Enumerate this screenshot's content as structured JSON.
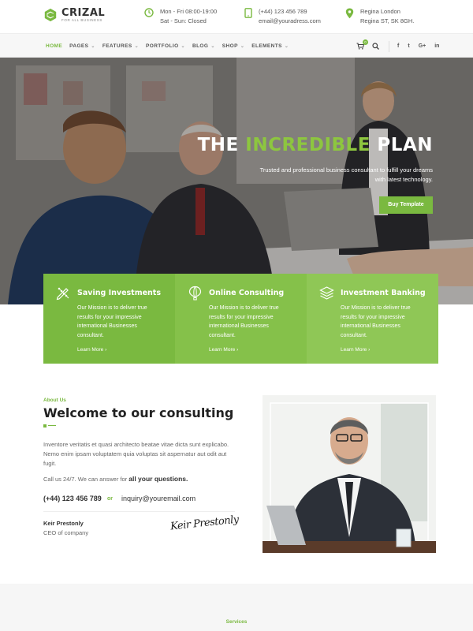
{
  "brand": {
    "name": "CRIZAL",
    "tagline": "FOR ALL BUSINESS",
    "accent": "#7ab940"
  },
  "contacts": [
    {
      "icon": "clock-icon",
      "line1": "Mon - Fri 08:00-19:00",
      "line2": "Sat - Sun: Closed"
    },
    {
      "icon": "phone-icon",
      "line1": "(+44) 123 456 789",
      "line2": "email@youradress.com"
    },
    {
      "icon": "map-pin-icon",
      "line1": "Regina London",
      "line2": "Regina ST, SK 8GH."
    }
  ],
  "nav": {
    "items": [
      "HOME",
      "PAGES",
      "FEATURES",
      "PORTFOLIO",
      "BLOG",
      "SHOP",
      "ELEMENTS"
    ],
    "active": "HOME",
    "cart_count": "0",
    "social": [
      "f",
      "t",
      "G+",
      "in"
    ]
  },
  "hero": {
    "title_part1": "THE ",
    "title_highlight": "INCREDIBLE",
    "title_part2": " PLAN",
    "subtitle": "Trusted and professional business consultant to fulfill your dreams with latest technology.",
    "button": "Buy Template"
  },
  "features": [
    {
      "icon": "pencil-ruler-icon",
      "title": "Saving Investments",
      "desc": "Our Mission is to deliver true results for your impressive international Businesses consultant.",
      "link": "Learn More"
    },
    {
      "icon": "hot-air-balloon-icon",
      "title": "Online Consulting",
      "desc": "Our Mission is to deliver true results for your impressive international Businesses consultant.",
      "link": "Learn More"
    },
    {
      "icon": "layers-icon",
      "title": "Investment Banking",
      "desc": "Our Mission is to deliver true results for your impressive international Businesses consultant.",
      "link": "Learn More"
    }
  ],
  "about": {
    "label": "About Us",
    "title": "Welcome to our consulting",
    "text": "Inventore veritatis et quasi architecto beatae vitae dicta sunt explicabo. Nemo enim ipsam voluptatem quia voluptas sit aspernatur aut odit aut fugit.",
    "call_text": "Call us 24/7. We can answer for ",
    "call_bold": "all your questions.",
    "phone": "(+44) 123 456 789",
    "or": "or",
    "email": "inquiry@youremail.com",
    "person": "Keir Prestonly",
    "role": "CEO of company",
    "signature": "Keir Prestonly"
  },
  "services": {
    "label": "Services"
  }
}
